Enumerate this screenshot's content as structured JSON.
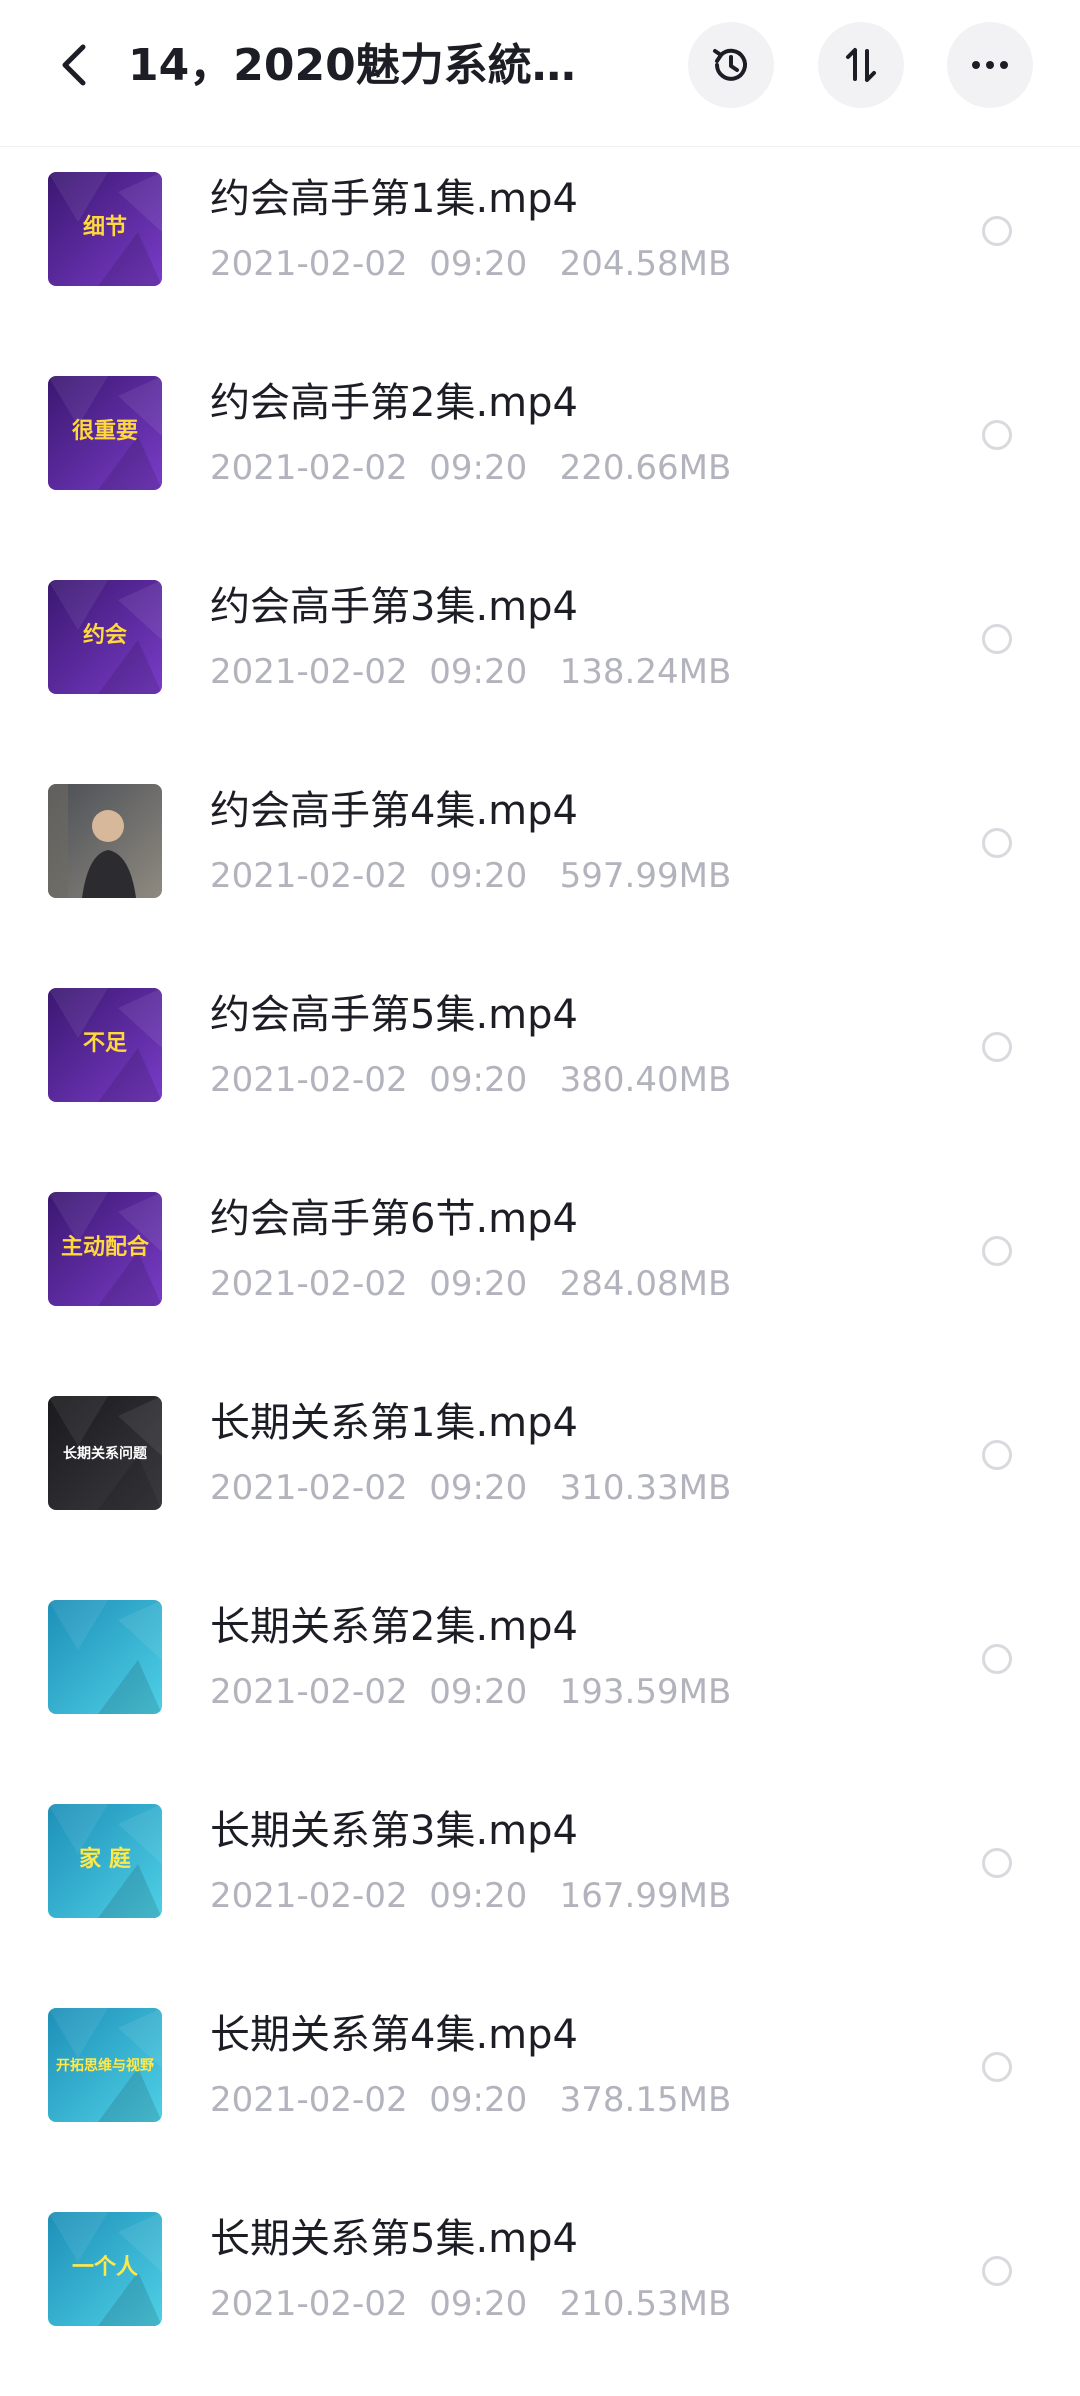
{
  "header": {
    "title": "14，2020魅力系統…",
    "icons": [
      "back-arrow-icon",
      "history-icon",
      "sort-icon",
      "more-icon"
    ]
  },
  "files": [
    {
      "name": "约会高手第1集.mp4",
      "date": "2021-02-02",
      "time": "09:20",
      "size": "204.58MB",
      "thumb_text": "细节",
      "thumb_style": "purple"
    },
    {
      "name": "约会高手第2集.mp4",
      "date": "2021-02-02",
      "time": "09:20",
      "size": "220.66MB",
      "thumb_text": "很重要",
      "thumb_style": "purple"
    },
    {
      "name": "约会高手第3集.mp4",
      "date": "2021-02-02",
      "time": "09:20",
      "size": "138.24MB",
      "thumb_text": "约会",
      "thumb_style": "purple"
    },
    {
      "name": "约会高手第4集.mp4",
      "date": "2021-02-02",
      "time": "09:20",
      "size": "597.99MB",
      "thumb_text": "",
      "thumb_style": "photo"
    },
    {
      "name": "约会高手第5集.mp4",
      "date": "2021-02-02",
      "time": "09:20",
      "size": "380.40MB",
      "thumb_text": "不足",
      "thumb_style": "purple"
    },
    {
      "name": "约会高手第6节.mp4",
      "date": "2021-02-02",
      "time": "09:20",
      "size": "284.08MB",
      "thumb_text": "主动配合",
      "thumb_style": "purple"
    },
    {
      "name": "长期关系第1集.mp4",
      "date": "2021-02-02",
      "time": "09:20",
      "size": "310.33MB",
      "thumb_text": "长期关系问题",
      "thumb_style": "dark"
    },
    {
      "name": "长期关系第2集.mp4",
      "date": "2021-02-02",
      "time": "09:20",
      "size": "193.59MB",
      "thumb_text": "",
      "thumb_style": "cyan"
    },
    {
      "name": "长期关系第3集.mp4",
      "date": "2021-02-02",
      "time": "09:20",
      "size": "167.99MB",
      "thumb_text": "家 庭",
      "thumb_style": "cyan"
    },
    {
      "name": "长期关系第4集.mp4",
      "date": "2021-02-02",
      "time": "09:20",
      "size": "378.15MB",
      "thumb_text": "开拓思维与视野",
      "thumb_style": "cyan"
    },
    {
      "name": "长期关系第5集.mp4",
      "date": "2021-02-02",
      "time": "09:20",
      "size": "210.53MB",
      "thumb_text": "一个人",
      "thumb_style": "cyan"
    }
  ],
  "colors": {
    "purple": "#5a2ba0",
    "cyan": "#2fb9d6",
    "dark": "#2a2a2e",
    "text": "#1d1d26",
    "meta": "#b3b3bd"
  }
}
